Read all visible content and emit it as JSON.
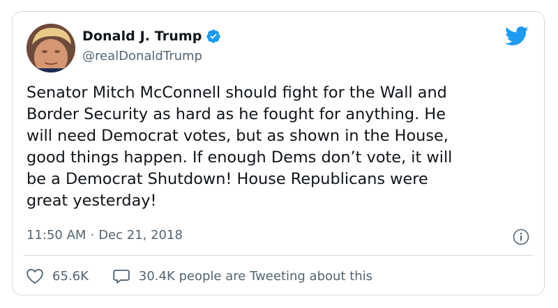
{
  "user": {
    "name": "Donald J. Trump",
    "handle": "@realDonaldTrump"
  },
  "tweet": {
    "text": "Senator Mitch McConnell should fight for the Wall and\nBorder Security as hard as he fought for anything. He\nwill need Democrat votes, but as shown in the House,\ngood things happen. If enough Dems don’t vote, it will\nbe a Democrat Shutdown! House Republicans were\ngreat yesterday!",
    "time": "11:50 AM",
    "separator": "·",
    "date": "Dec 21, 2018"
  },
  "actions": {
    "likes": "65.6K",
    "tweeting": "30.4K people are Tweeting about this"
  },
  "icons": {
    "brand": "twitter-bird-icon",
    "verified": "verified-badge-icon",
    "info": "info-icon",
    "like": "heart-icon",
    "reply": "speech-bubble-icon"
  },
  "colors": {
    "brand_blue": "#1d9bf0",
    "text": "#0f1419",
    "muted": "#536471",
    "border": "#cfd9de"
  }
}
